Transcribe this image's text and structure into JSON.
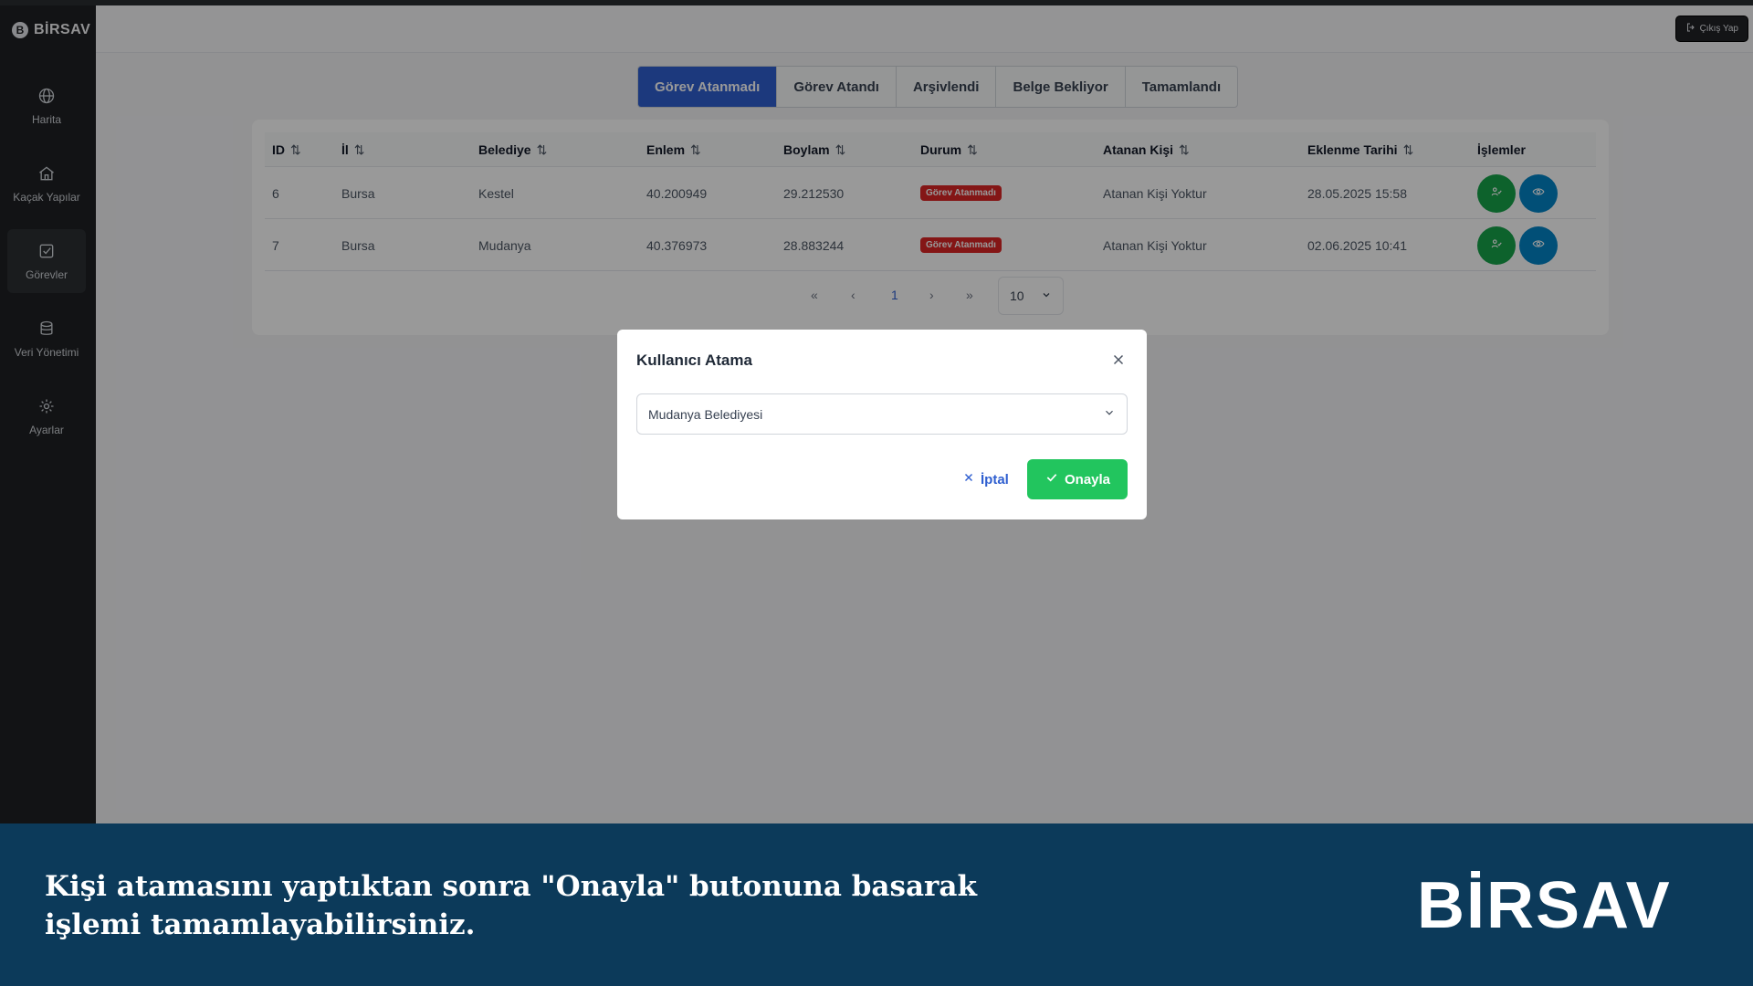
{
  "brand": {
    "name": "BİRSAV",
    "mark": "B"
  },
  "header": {
    "logout_label": "Çıkış Yap"
  },
  "sidebar": {
    "items": [
      {
        "label": "Harita",
        "icon": "globe-icon"
      },
      {
        "label": "Kaçak Yapılar",
        "icon": "home-icon"
      },
      {
        "label": "Görevler",
        "icon": "checkbox-icon",
        "active": true
      },
      {
        "label": "Veri Yönetimi",
        "icon": "database-icon"
      },
      {
        "label": "Ayarlar",
        "icon": "gear-icon"
      }
    ]
  },
  "tabs": [
    {
      "label": "Görev Atanmadı",
      "active": true
    },
    {
      "label": "Görev Atandı"
    },
    {
      "label": "Arşivlendi"
    },
    {
      "label": "Belge Bekliyor"
    },
    {
      "label": "Tamamlandı"
    }
  ],
  "table": {
    "columns": [
      "ID",
      "İl",
      "Belediye",
      "Enlem",
      "Boylam",
      "Durum",
      "Atanan Kişi",
      "Eklenme Tarihi",
      "İşlemler"
    ],
    "sort_icon": "⇅",
    "rows": [
      {
        "id": "6",
        "il": "Bursa",
        "belediye": "Kestel",
        "enlem": "40.200949",
        "boylam": "29.212530",
        "durum": "Görev Atanmadı",
        "atanan": "Atanan Kişi Yoktur",
        "tarih": "28.05.2025 15:58"
      },
      {
        "id": "7",
        "il": "Bursa",
        "belediye": "Mudanya",
        "enlem": "40.376973",
        "boylam": "28.883244",
        "durum": "Görev Atanmadı",
        "atanan": "Atanan Kişi Yoktur",
        "tarih": "02.06.2025 10:41"
      }
    ]
  },
  "pagination": {
    "first": "«",
    "prev": "‹",
    "current_page": "1",
    "next": "›",
    "last": "»",
    "page_size": "10"
  },
  "modal": {
    "title": "Kullanıcı Atama",
    "selected_value": "Mudanya Belediyesi",
    "cancel_label": "İptal",
    "confirm_label": "Onayla"
  },
  "banner": {
    "line1": "Kişi atamasını yaptıktan sonra \"Onayla\" butonuna basarak",
    "line2": "işlemi tamamlayabilirsiniz.",
    "logo": "BİRSAV"
  },
  "colors": {
    "accent": "#2f5fd0",
    "status_badge": "#dc2626",
    "confirm": "#22c55e",
    "banner_bg": "#0c3a5a"
  }
}
